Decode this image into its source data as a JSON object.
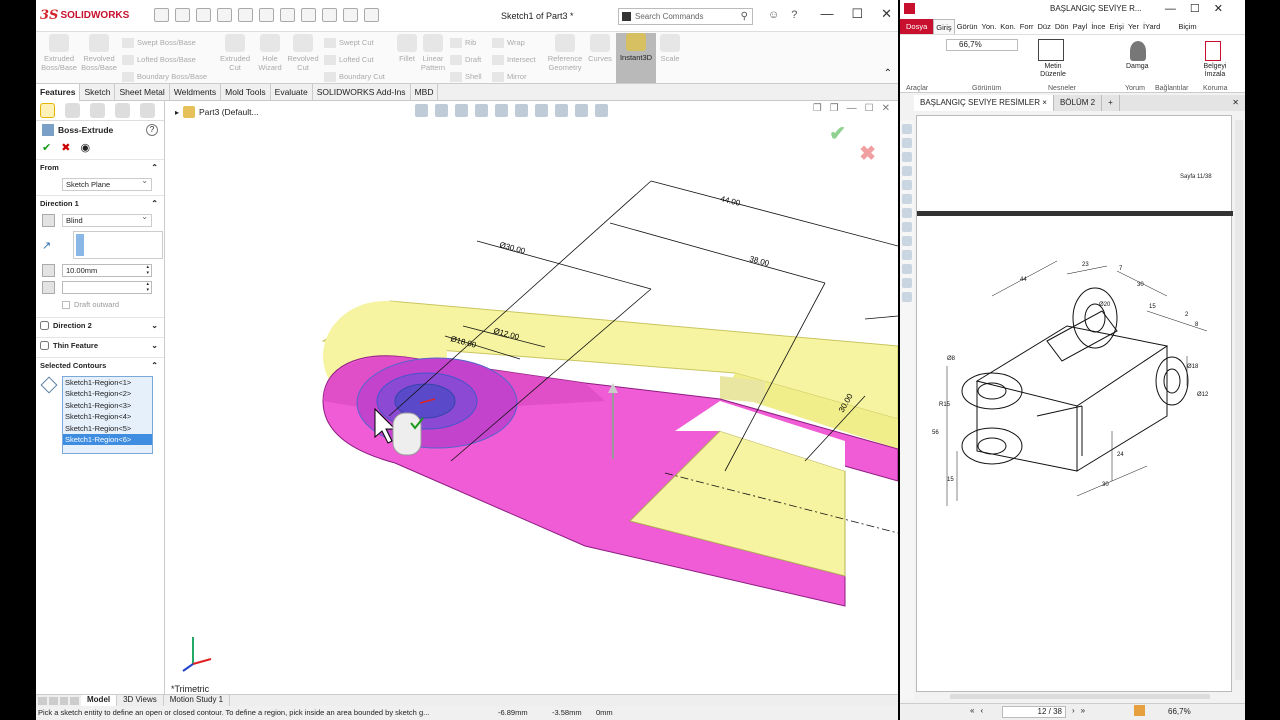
{
  "sw": {
    "logo": "SOLIDWORKS",
    "doc_title": "Sketch1 of Part3 *",
    "search_placeholder": "Search Commands",
    "commands": {
      "extruded_boss": "Extruded Boss/Base",
      "revolved_boss": "Revolved Boss/Base",
      "swept_boss": "Swept Boss/Base",
      "lofted_boss": "Lofted Boss/Base",
      "boundary_boss": "Boundary Boss/Base",
      "extruded_cut": "Extruded Cut",
      "hole_wizard": "Hole Wizard",
      "revolved_cut": "Revolved Cut",
      "swept_cut": "Swept Cut",
      "lofted_cut": "Lofted Cut",
      "boundary_cut": "Boundary Cut",
      "fillet": "Fillet",
      "linear_pattern": "Linear Pattern",
      "rib": "Rib",
      "draft": "Draft",
      "shell": "Shell",
      "wrap": "Wrap",
      "intersect": "Intersect",
      "mirror": "Mirror",
      "reference_geometry": "Reference Geometry",
      "curves": "Curves",
      "instant3d": "Instant3D",
      "scale": "Scale"
    },
    "tabs": [
      "Features",
      "Sketch",
      "Sheet Metal",
      "Weldments",
      "Mold Tools",
      "Evaluate",
      "SOLIDWORKS Add-Ins",
      "MBD"
    ],
    "pm": {
      "title": "Boss-Extrude",
      "from_label": "From",
      "from_value": "Sketch Plane",
      "dir1_label": "Direction 1",
      "dir1_type": "Blind",
      "depth": "10.00mm",
      "draft_outward": "Draft outward",
      "dir2_label": "Direction 2",
      "thin_label": "Thin Feature",
      "contours_label": "Selected Contours",
      "contours": [
        "Sketch1-Region<1>",
        "Sketch1-Region<2>",
        "Sketch1-Region<3>",
        "Sketch1-Region<4>",
        "Sketch1-Region<5>",
        "Sketch1-Region<6>"
      ]
    },
    "breadcrumb": "Part3 (Default...",
    "dims": {
      "d44": "44.00",
      "d38": "38.00",
      "d30": "Ø30.00",
      "d12": "Ø12.00",
      "d18": "Ø18.00",
      "r30": "30.00"
    },
    "view_name": "*Trimetric",
    "bottom_tabs": [
      "Model",
      "3D Views",
      "Motion Study 1"
    ],
    "status": {
      "hint": "Pick a sketch entity to define an open or closed contour. To define a region, pick inside an area bounded by sketch g...",
      "x": "-6.89mm",
      "y": "-3.58mm",
      "z": "0mm"
    }
  },
  "pdf": {
    "title": "BAŞLANGIÇ SEVİYE R...",
    "ribbon_tabs": [
      "Dosya",
      "Giriş",
      "Görün",
      "Yon.",
      "Kon.",
      "Forr",
      "Düz",
      "Dön",
      "Payl",
      "İnce",
      "Erişi",
      "Yer",
      "İYard",
      "Biçim"
    ],
    "zoom_top": "66,7%",
    "tool_labels": {
      "metin": "Metin Düzenle",
      "damga": "Damga",
      "belge": "Belgeyi İmzala"
    },
    "groups": [
      "Araçlar",
      "Görünüm",
      "Nesneler",
      "Yorum",
      "Bağlantılar",
      "Koruma"
    ],
    "doc_tabs": [
      "BAŞLANGIÇ SEVİYE RESİMLER",
      "BÖLÜM 2"
    ],
    "page_label": "Sayfa 11/38",
    "drawing_dims": {
      "d23": "23",
      "d44": "44",
      "d7": "7",
      "d30": "30",
      "d15": "15",
      "d2": "2",
      "d8": "8",
      "d56": "56",
      "d24": "24",
      "d30b": "30",
      "d15b": "15",
      "r15": "R15",
      "o18": "Ø18",
      "o12": "Ø12",
      "o20": "Ø20",
      "o8": "Ø8"
    },
    "page_counter": "12 / 38",
    "zoom_bottom": "66,7%"
  }
}
